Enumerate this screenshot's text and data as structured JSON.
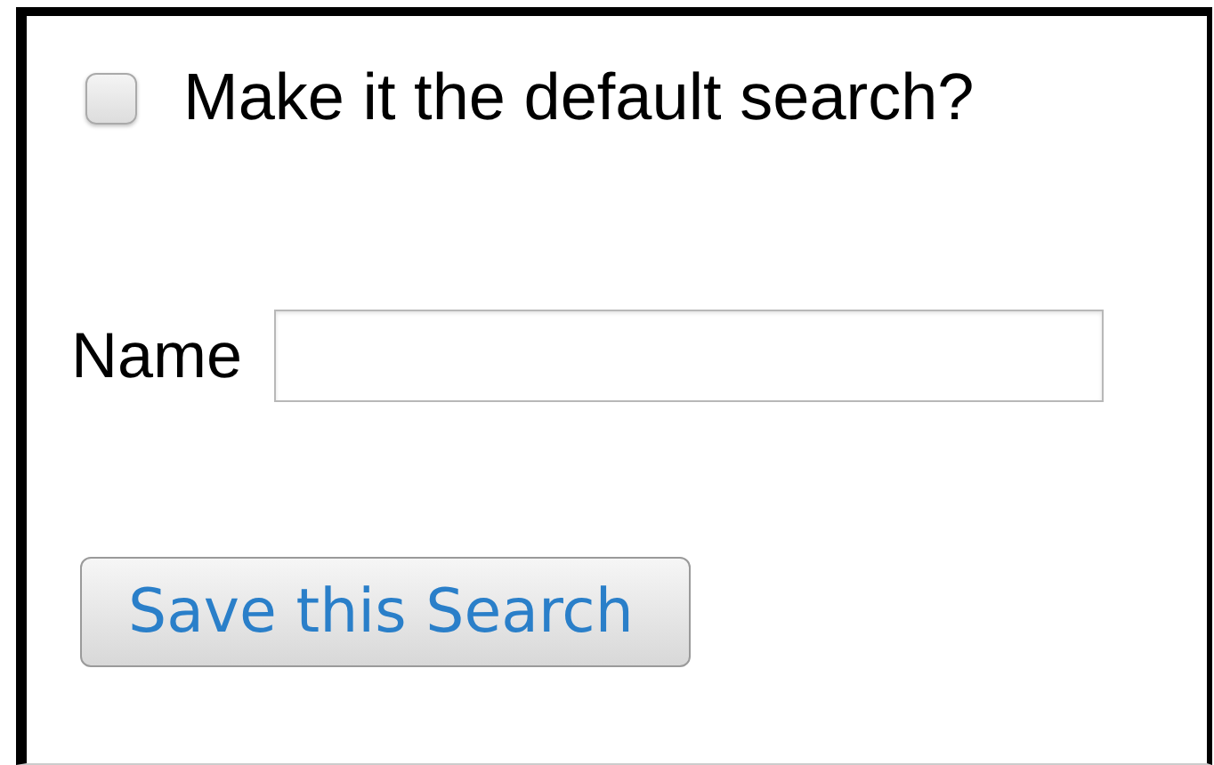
{
  "default_search": {
    "label": "Make it the default search?",
    "checked": false
  },
  "name_field": {
    "label": "Name"
  },
  "save_button": {
    "label": "Save this Search"
  }
}
